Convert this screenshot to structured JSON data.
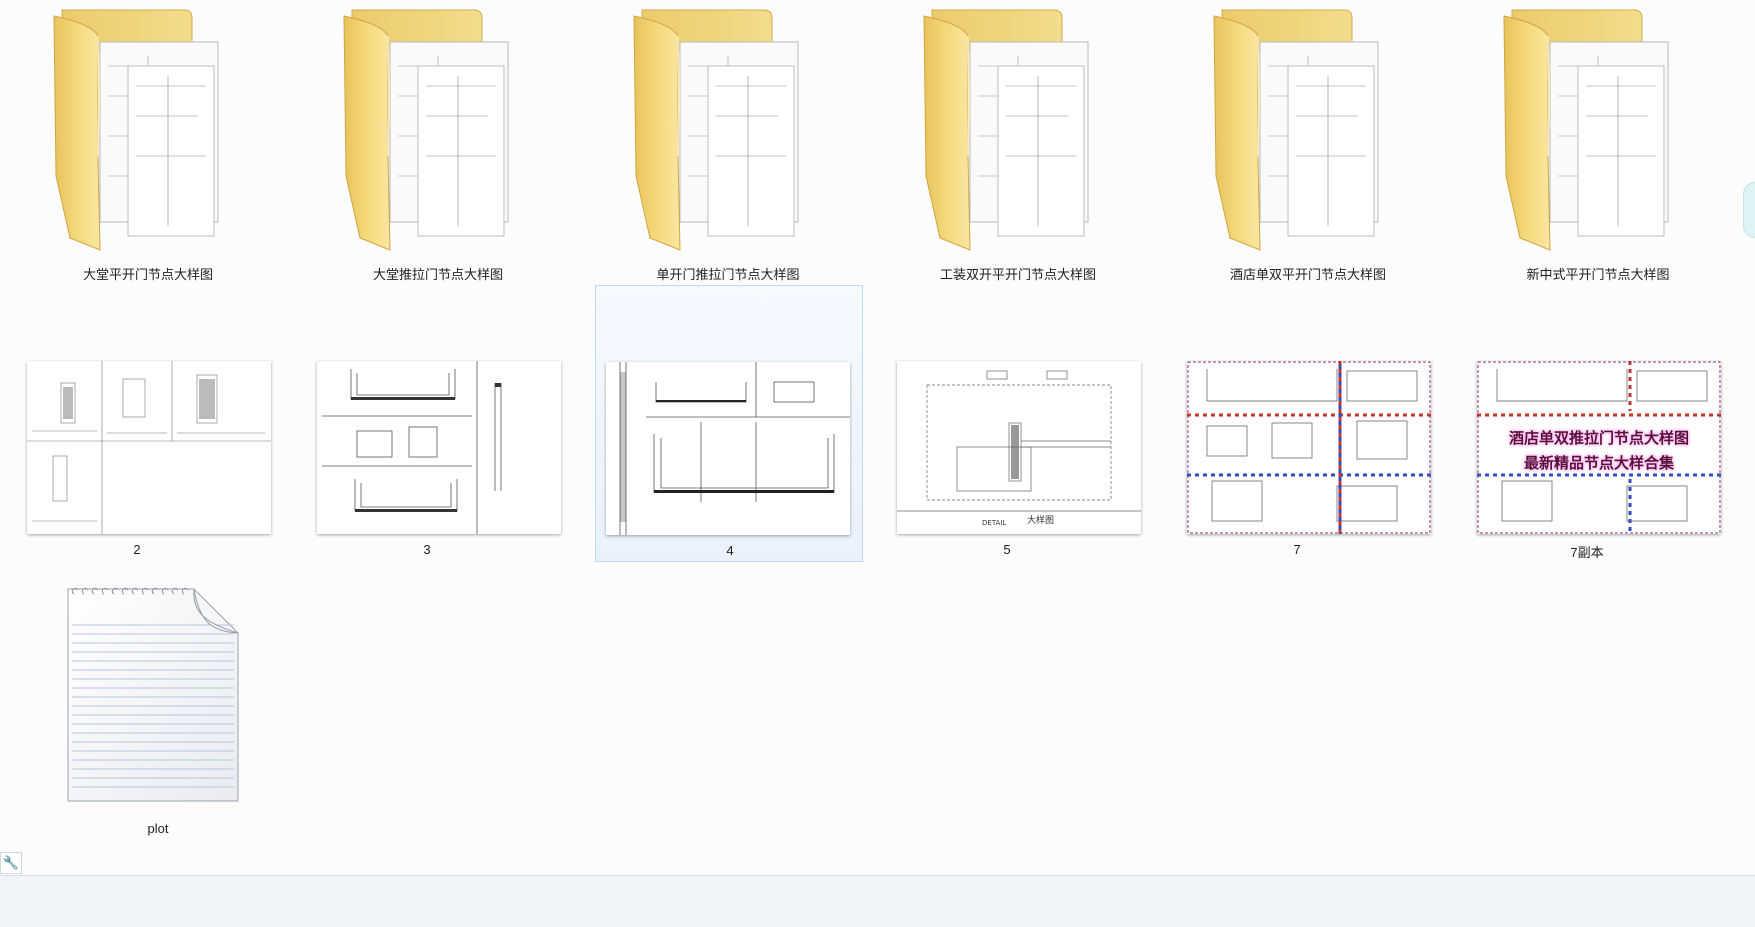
{
  "folders": [
    {
      "label": "大堂平开门节点大样图"
    },
    {
      "label": "大堂推拉门节点大样图"
    },
    {
      "label": "单开门推拉门节点大样图"
    },
    {
      "label": "工装双开平开门节点大样图"
    },
    {
      "label": "酒店单双平开门节点大样图"
    },
    {
      "label": "新中式平开门节点大样图"
    }
  ],
  "images": [
    {
      "label": "2"
    },
    {
      "label": "3"
    },
    {
      "label": "4",
      "selected": true
    },
    {
      "label": "5"
    },
    {
      "label": "7"
    },
    {
      "label": "7副本"
    }
  ],
  "thumb5": {
    "title_text": "大样图",
    "small_text": "DETAIL"
  },
  "watermark": {
    "line1": "酒店单双推拉门节点大样图",
    "line2": "最新精品节点大样合集"
  },
  "document": {
    "label": "plot",
    "icon": "text-document-icon"
  },
  "status": {
    "tool_icon": "wrench-icon"
  },
  "colors": {
    "folder_front": "#f6d97c",
    "folder_back": "#eccb6b",
    "selection_bg": "#e8f1fc",
    "selection_border": "#c1d8f2",
    "watermark_text": "#5c0f3f"
  }
}
